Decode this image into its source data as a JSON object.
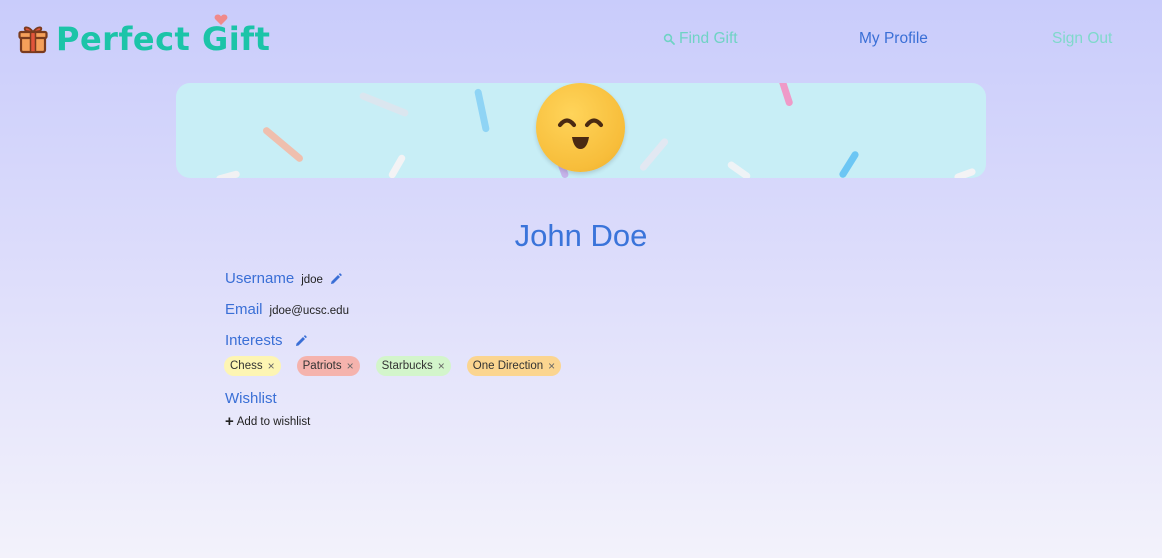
{
  "nav": {
    "logo_text": "Perfect Gift",
    "find_gift": "Find Gift",
    "my_profile": "My Profile",
    "sign_out": "Sign Out"
  },
  "profile": {
    "name": "John Doe",
    "username_label": "Username",
    "username": "jdoe",
    "email_label": "Email",
    "email": "jdoe@ucsc.edu",
    "interests_label": "Interests",
    "interests": [
      {
        "label": "Chess",
        "color": "#fdf5b3"
      },
      {
        "label": "Patriots",
        "color": "#f5b3ad"
      },
      {
        "label": "Starbucks",
        "color": "#d3f5cb"
      },
      {
        "label": "One Direction",
        "color": "#fbd590"
      }
    ],
    "remove_glyph": "×",
    "wishlist_label": "Wishlist",
    "add_wishlist": "Add to wishlist"
  },
  "colors": {
    "brand": "#1cc4a8",
    "accent": "#3a6fd6",
    "banner": "#c8eef6",
    "avatar": "#f7bd3a"
  }
}
